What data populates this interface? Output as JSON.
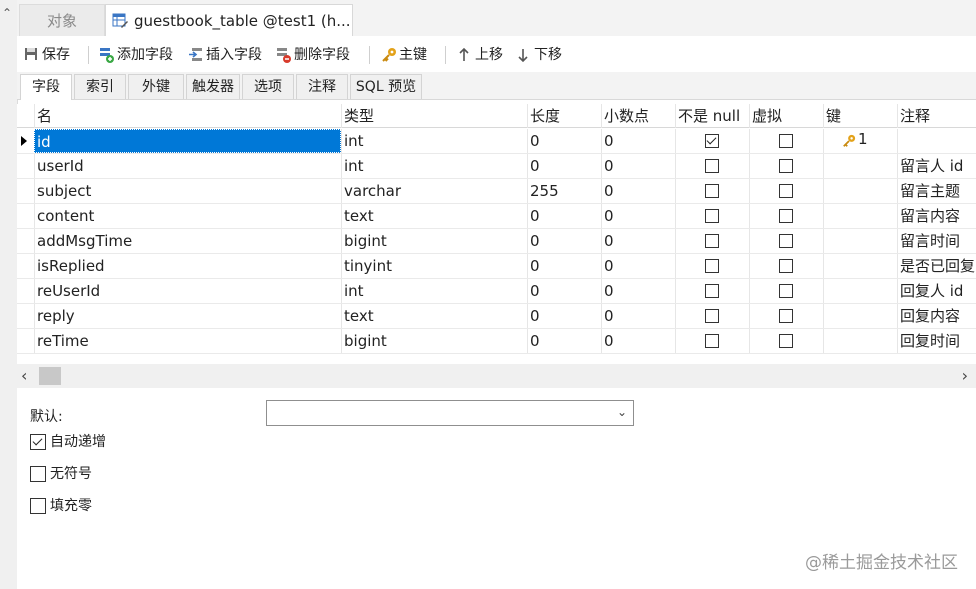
{
  "tabs": {
    "objects": "对象",
    "table": "guestbook_table @test1 (h..."
  },
  "toolbar": {
    "save": "保存",
    "add_field": "添加字段",
    "insert_field": "插入字段",
    "delete_field": "删除字段",
    "primary_key": "主键",
    "move_up": "上移",
    "move_down": "下移"
  },
  "subtabs": [
    "字段",
    "索引",
    "外键",
    "触发器",
    "选项",
    "注释",
    "SQL 预览"
  ],
  "grid": {
    "columns": [
      "名",
      "类型",
      "长度",
      "小数点",
      "不是 null",
      "虚拟",
      "键",
      "注释"
    ],
    "rows": [
      {
        "name": "id",
        "type": "int",
        "length": "0",
        "decimals": "0",
        "not_null": true,
        "virtual": false,
        "key": "1",
        "comment": ""
      },
      {
        "name": "userId",
        "type": "int",
        "length": "0",
        "decimals": "0",
        "not_null": false,
        "virtual": false,
        "key": "",
        "comment": "留言人 id"
      },
      {
        "name": "subject",
        "type": "varchar",
        "length": "255",
        "decimals": "0",
        "not_null": false,
        "virtual": false,
        "key": "",
        "comment": "留言主题"
      },
      {
        "name": "content",
        "type": "text",
        "length": "0",
        "decimals": "0",
        "not_null": false,
        "virtual": false,
        "key": "",
        "comment": "留言内容"
      },
      {
        "name": "addMsgTime",
        "type": "bigint",
        "length": "0",
        "decimals": "0",
        "not_null": false,
        "virtual": false,
        "key": "",
        "comment": "留言时间"
      },
      {
        "name": "isReplied",
        "type": "tinyint",
        "length": "0",
        "decimals": "0",
        "not_null": false,
        "virtual": false,
        "key": "",
        "comment": "是否已回复"
      },
      {
        "name": "reUserId",
        "type": "int",
        "length": "0",
        "decimals": "0",
        "not_null": false,
        "virtual": false,
        "key": "",
        "comment": "回复人 id"
      },
      {
        "name": "reply",
        "type": "text",
        "length": "0",
        "decimals": "0",
        "not_null": false,
        "virtual": false,
        "key": "",
        "comment": "回复内容"
      },
      {
        "name": "reTime",
        "type": "bigint",
        "length": "0",
        "decimals": "0",
        "not_null": false,
        "virtual": false,
        "key": "",
        "comment": "回复时间"
      }
    ]
  },
  "props": {
    "default_label": "默认:",
    "default_value": "",
    "auto_increment": "自动递增",
    "auto_increment_checked": true,
    "unsigned": "无符号",
    "unsigned_checked": false,
    "zerofill": "填充零",
    "zerofill_checked": false
  },
  "watermark": "@稀土掘金技术社区",
  "colors": {
    "selection": "#0078d7",
    "key_icon": "#e3a21a"
  }
}
